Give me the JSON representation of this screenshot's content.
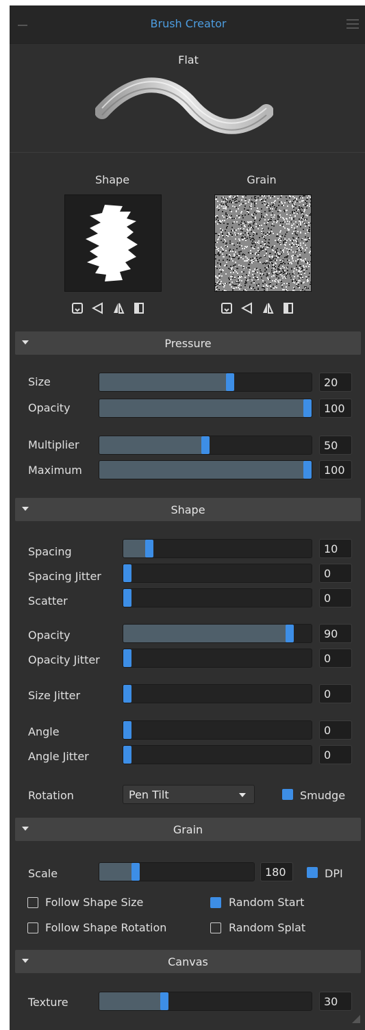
{
  "window": {
    "title": "Brush Creator"
  },
  "preset": {
    "name": "Flat"
  },
  "thumbnails": {
    "shape_label": "Shape",
    "grain_label": "Grain"
  },
  "sections": {
    "pressure": "Pressure",
    "shape": "Shape",
    "grain": "Grain",
    "canvas": "Canvas"
  },
  "pressure": {
    "size": {
      "label": "Size",
      "value": "20",
      "level": 0.62
    },
    "opacity": {
      "label": "Opacity",
      "value": "100",
      "level": 1.0
    },
    "multiplier": {
      "label": "Multiplier",
      "value": "50",
      "level": 0.5
    },
    "maximum": {
      "label": "Maximum",
      "value": "100",
      "level": 1.0
    }
  },
  "shape": {
    "spacing": {
      "label": "Spacing",
      "value": "10",
      "level": 0.12
    },
    "spacing_jitter": {
      "label": "Spacing Jitter",
      "value": "0",
      "level": 0
    },
    "scatter": {
      "label": "Scatter",
      "value": "0",
      "level": 0
    },
    "opacity": {
      "label": "Opacity",
      "value": "90",
      "level": 0.9
    },
    "opacity_jitter": {
      "label": "Opacity Jitter",
      "value": "0",
      "level": 0
    },
    "size_jitter": {
      "label": "Size Jitter",
      "value": "0",
      "level": 0
    },
    "angle": {
      "label": "Angle",
      "value": "0",
      "level": 0
    },
    "angle_jitter": {
      "label": "Angle Jitter",
      "value": "0",
      "level": 0
    },
    "rotation_label": "Rotation",
    "rotation_value": "Pen Tilt",
    "smudge_label": "Smudge",
    "smudge_checked": true
  },
  "grain": {
    "scale": {
      "label": "Scale",
      "value": "180",
      "level": 0.22
    },
    "dpi_label": "DPI",
    "dpi_checked": true,
    "follow_shape_size": "Follow Shape Size",
    "follow_shape_size_checked": false,
    "random_start": "Random Start",
    "random_start_checked": true,
    "follow_shape_rotation": "Follow Shape Rotation",
    "follow_shape_rotation_checked": false,
    "random_splat": "Random Splat",
    "random_splat_checked": false
  },
  "canvas": {
    "texture": {
      "label": "Texture",
      "value": "30",
      "level": 0.3
    }
  },
  "colors": {
    "accent": "#3d8ee6",
    "title": "#4d9de0",
    "panel": "#2f2f2f",
    "section": "#434343"
  }
}
